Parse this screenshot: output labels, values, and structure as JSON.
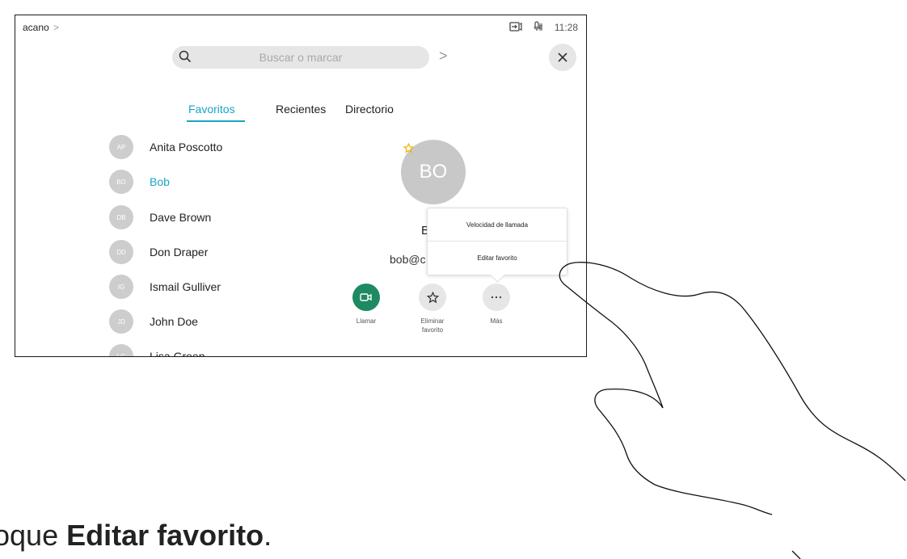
{
  "status_bar": {
    "brand": "acano",
    "brand_chevron": ">",
    "time": "11:28"
  },
  "search": {
    "placeholder": "Buscar o marcar",
    "next_chevron": ">"
  },
  "tabs": [
    {
      "label": "Favoritos",
      "active": true
    },
    {
      "label": "Recientes"
    },
    {
      "label": "Directorio"
    }
  ],
  "contacts": [
    {
      "initials": "AP",
      "name": "Anita Poscotto"
    },
    {
      "initials": "BO",
      "name": "Bob",
      "selected": true
    },
    {
      "initials": "DB",
      "name": "Dave Brown"
    },
    {
      "initials": "DD",
      "name": "Don Draper"
    },
    {
      "initials": "IG",
      "name": "Ismail Gulliver"
    },
    {
      "initials": "JD",
      "name": "John Doe"
    },
    {
      "initials": "LG",
      "name": "Lisa Green"
    }
  ],
  "detail": {
    "initials": "BO",
    "name_visible": "B",
    "email_visible": "bob@c"
  },
  "popover": {
    "items": [
      "Velocidad de llamada",
      "Editar favorito"
    ]
  },
  "actions": [
    {
      "label": "Llamar",
      "icon": "camera-icon",
      "color": "#1d8a62"
    },
    {
      "label": "Eliminar favorito",
      "icon": "star-outline-icon",
      "color": "#e6e6e6"
    },
    {
      "label": "Más",
      "icon": "more-icon",
      "color": "#e6e6e6"
    }
  ],
  "instruction": {
    "prefix": "oque ",
    "bold": "Editar favorito",
    "suffix": "."
  },
  "colors": {
    "accent": "#1ba4c6",
    "call_green": "#1d8a62",
    "favorite_star": "#f0b400"
  }
}
